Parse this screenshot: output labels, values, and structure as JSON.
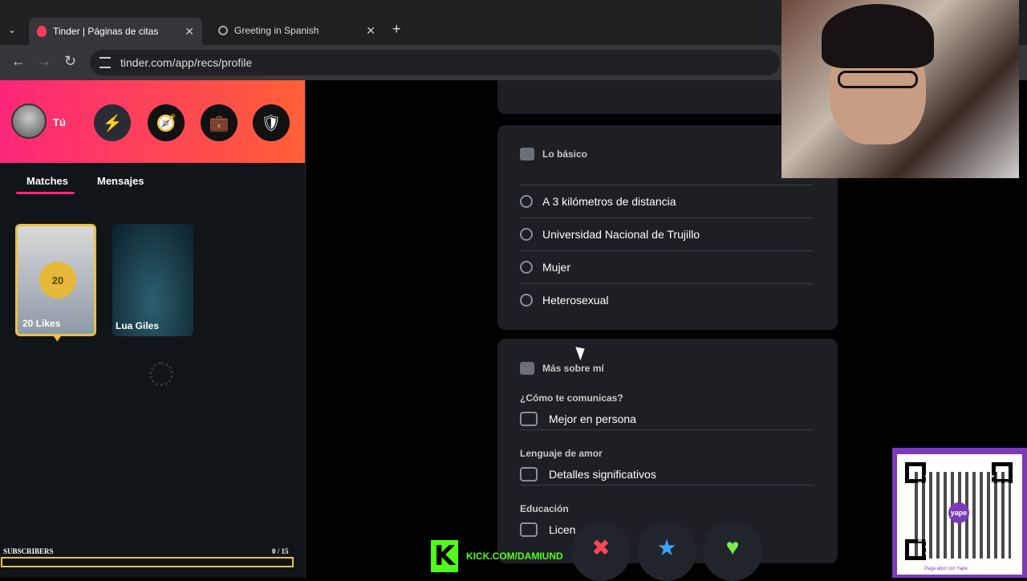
{
  "browser": {
    "tabs": [
      {
        "title": "Tinder | Páginas de citas",
        "active": true
      },
      {
        "title": "Greeting in Spanish",
        "active": false
      }
    ],
    "url": "tinder.com/app/recs/profile"
  },
  "sidebar": {
    "user_label": "Tú",
    "tabs": {
      "matches": "Matches",
      "messages": "Mensajes"
    },
    "likes_card": {
      "count": "20",
      "label": "20 Likes"
    },
    "match_card": {
      "name": "Lua Giles"
    }
  },
  "profile": {
    "basics": {
      "title": "Lo básico",
      "items": [
        {
          "icon": "location-pin-icon",
          "text": "A 3 kilómetros de distancia"
        },
        {
          "icon": "graduation-cap-icon",
          "text": "Universidad Nacional de Trujillo"
        },
        {
          "icon": "person-icon",
          "text": "Mujer"
        },
        {
          "icon": "orientation-icon",
          "text": "Heterosexual"
        }
      ]
    },
    "more_about_me": {
      "title": "Más sobre mí",
      "items": [
        {
          "label": "¿Cómo te comunicas?",
          "value": "Mejor en persona"
        },
        {
          "label": "Lenguaje de amor",
          "value": "Detalles significativos"
        },
        {
          "label": "Educación",
          "value": "Licen"
        }
      ]
    }
  },
  "overlay": {
    "kick_url": "KICK.COM/DAMIUND",
    "subscribers_label": "SUBSCRIBERS",
    "subscribers_count": "0 / 15",
    "qr_badge": "yape",
    "qr_caption": "Paga aquí con Yape"
  },
  "colors": {
    "tinder_gradient_start": "#fd267a",
    "tinder_gradient_end": "#ff6036",
    "nope": "#ff4458",
    "super_like": "#3ca4ff",
    "like": "#7bed44",
    "kick_green": "#53fc18",
    "likes_gold": "#e7c245"
  }
}
